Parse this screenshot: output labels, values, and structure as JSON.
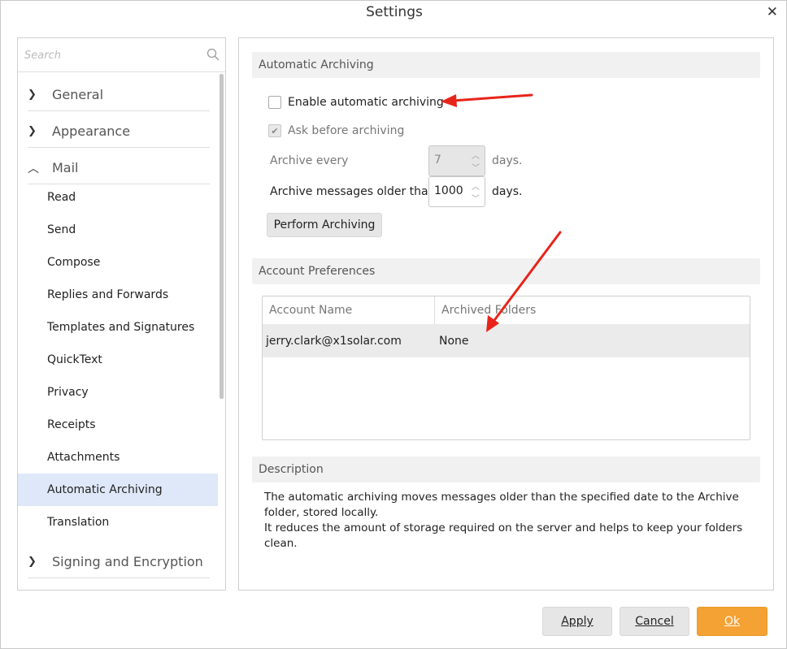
{
  "window": {
    "title": "Settings",
    "close_glyph": "✕"
  },
  "sidebar": {
    "search_placeholder": "Search",
    "categories": [
      {
        "label": "General",
        "expanded": false
      },
      {
        "label": "Appearance",
        "expanded": false
      },
      {
        "label": "Mail",
        "expanded": true
      },
      {
        "label": "Signing and Encryption",
        "expanded": false
      }
    ],
    "mail_items": [
      "Read",
      "Send",
      "Compose",
      "Replies and Forwards",
      "Templates and Signatures",
      "QuickText",
      "Privacy",
      "Receipts",
      "Attachments",
      "Automatic Archiving",
      "Translation"
    ],
    "active_item": "Automatic Archiving"
  },
  "archiving": {
    "section_title": "Automatic Archiving",
    "enable_label": "Enable automatic archiving",
    "enable_checked": false,
    "ask_label": "Ask before archiving",
    "ask_checked": true,
    "archive_every_label": "Archive every",
    "archive_every_value": "7",
    "archive_every_unit": "days.",
    "older_than_label": "Archive messages older than",
    "older_than_value": "1000",
    "older_than_unit": "days.",
    "perform_button": "Perform Archiving"
  },
  "accounts": {
    "section_title": "Account Preferences",
    "columns": [
      "Account Name",
      "Archived Folders"
    ],
    "rows": [
      {
        "account": "jerry.clark@x1solar.com",
        "folders": "None"
      }
    ]
  },
  "description": {
    "section_title": "Description",
    "line1": "The automatic archiving moves messages older than the specified date to the Archive folder, stored locally.",
    "line2": "It reduces the amount of storage required on the server and helps to keep your folders clean."
  },
  "footer": {
    "apply": "Apply",
    "cancel": "Cancel",
    "ok": "Ok"
  },
  "colors": {
    "accent": "#f4a233",
    "selection": "#dfe8f8",
    "annotation_arrow": "#e8241a"
  }
}
